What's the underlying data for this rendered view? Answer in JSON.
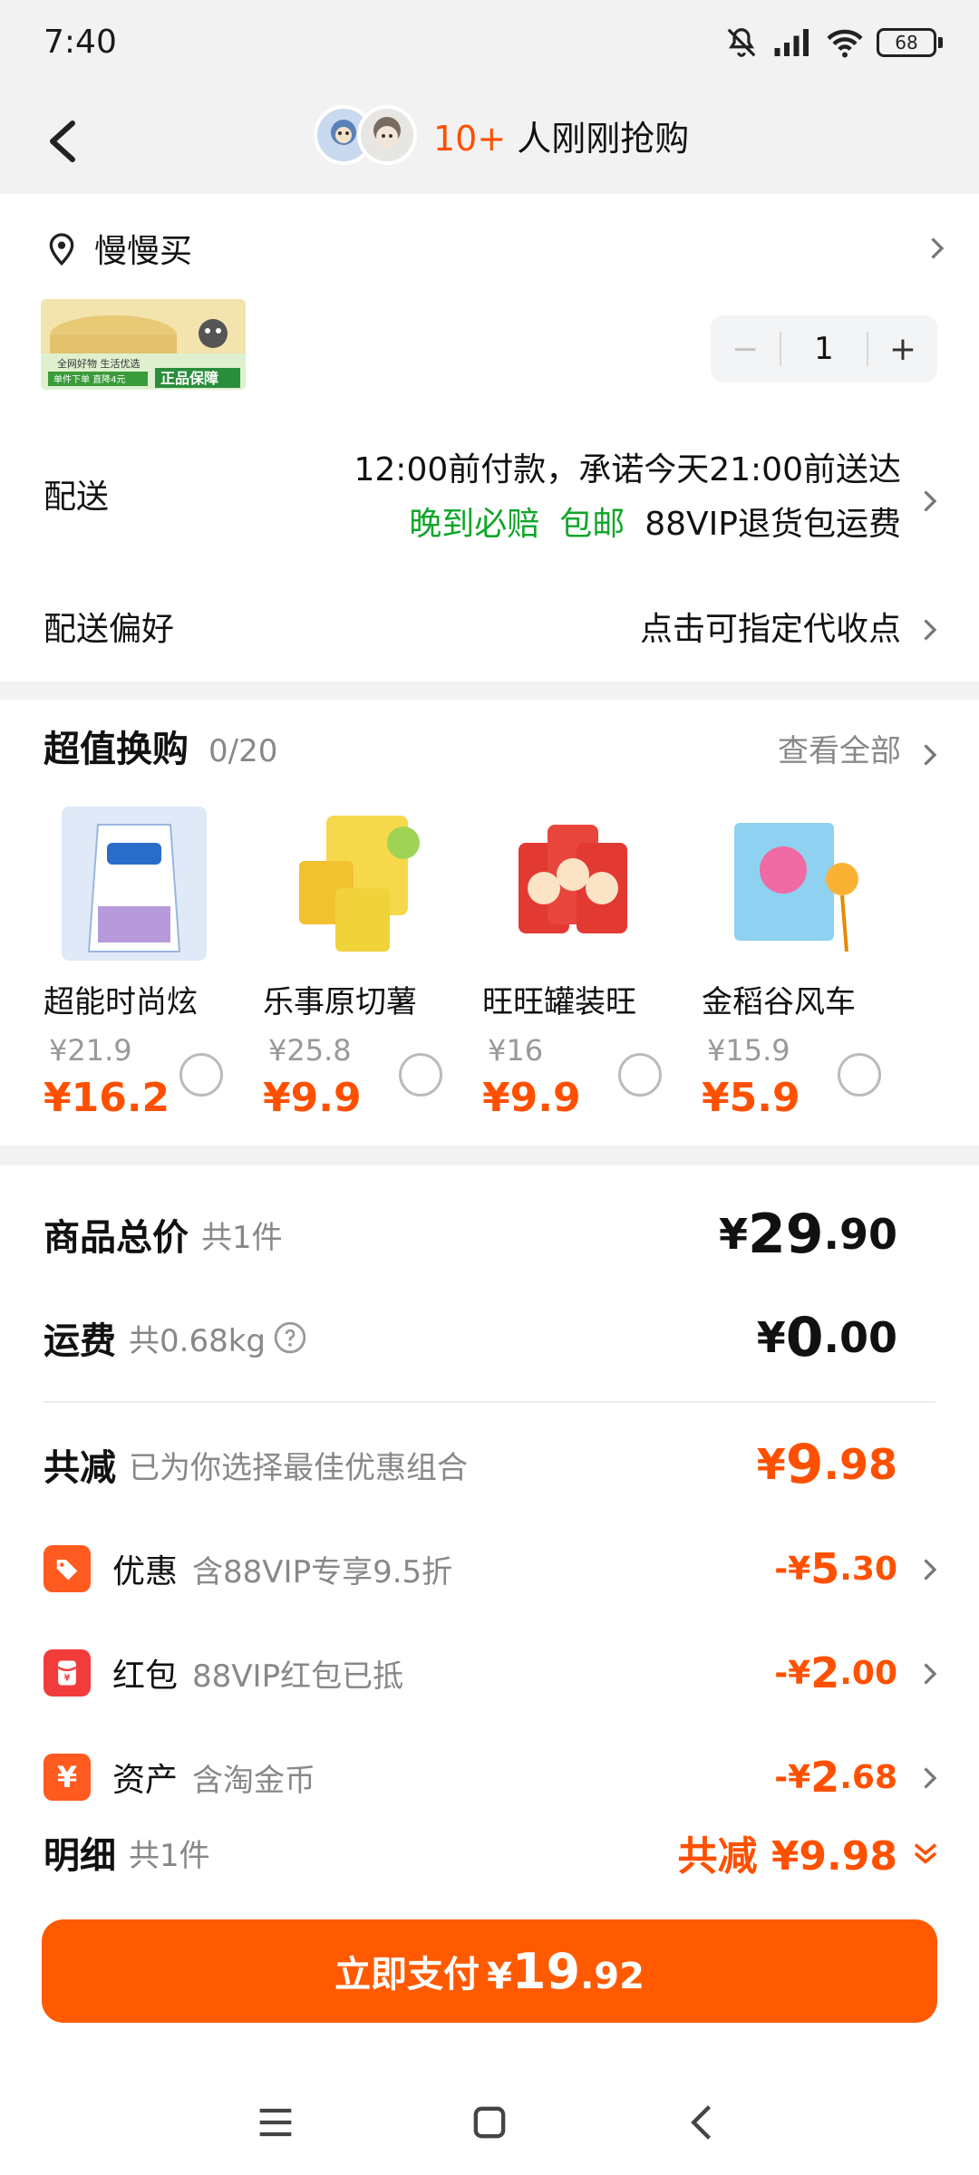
{
  "status_bar": {
    "time": "7:40",
    "battery": "68"
  },
  "header": {
    "buyers_count": "10+",
    "buyers_text": " 人刚刚抢购"
  },
  "address": {
    "name": "慢慢买"
  },
  "product": {
    "banner_line1": "全网好物 生活优选",
    "banner_line2": "单件下单 直降4元",
    "banner_badge": "正品保障",
    "quantity": "1",
    "minus": "−",
    "plus": "+"
  },
  "delivery": {
    "label": "配送",
    "promise": "12:00前付款，承诺今天21:00前送达",
    "tag_late": "晚到必赔",
    "tag_free": "包邮",
    "tag_vip": "88VIP退货包运费"
  },
  "preference": {
    "label": "配送偏好",
    "value": "点击可指定代收点"
  },
  "swap": {
    "title": "超值换购",
    "count": "0/20",
    "view_all": "查看全部",
    "items": [
      {
        "name": "超能时尚炫",
        "old_price": "¥21.9",
        "new_price": "¥16.2",
        "color": "#dfe9f7"
      },
      {
        "name": "乐事原切薯",
        "old_price": "¥25.8",
        "new_price": "¥9.9",
        "color": "#f6d94a"
      },
      {
        "name": "旺旺罐装旺",
        "old_price": "¥16",
        "new_price": "¥9.9",
        "color": "#e23a32"
      },
      {
        "name": "金稻谷风车",
        "old_price": "¥15.9",
        "new_price": "¥5.9",
        "color": "#8fd1f0"
      }
    ]
  },
  "summary": {
    "total": {
      "title": "商品总价",
      "sub": "共1件",
      "currency": "¥",
      "int": "29",
      "dec": ".90"
    },
    "shipping": {
      "title": "运费",
      "sub": "共0.68kg",
      "currency": "¥",
      "int": "0",
      "dec": ".00"
    },
    "reduce": {
      "title": "共减",
      "sub": "已为你选择最佳优惠组合",
      "currency": "¥",
      "int": "9",
      "dec": ".98"
    },
    "discounts": [
      {
        "icon": "tag-icon",
        "title": "优惠",
        "sub": "含88VIP专享9.5折",
        "prefix": "-¥",
        "int": "5",
        "dec": ".30"
      },
      {
        "icon": "red-envelope-icon",
        "title": "红包",
        "sub": "88VIP红包已抵",
        "prefix": "-¥",
        "int": "2",
        "dec": ".00"
      },
      {
        "icon": "yen-icon",
        "title": "资产",
        "sub": "含淘金币",
        "prefix": "-¥",
        "int": "2",
        "dec": ".68"
      }
    ],
    "detail": {
      "title": "明细",
      "sub": "共1件",
      "amount": "共减 ¥9.98"
    }
  },
  "pay": {
    "label": "立即支付",
    "currency": "¥",
    "int": "19",
    "dec": ".92"
  },
  "colors": {
    "accent": "#ff5000",
    "green": "#11a52a",
    "button": "#ff5a00"
  }
}
